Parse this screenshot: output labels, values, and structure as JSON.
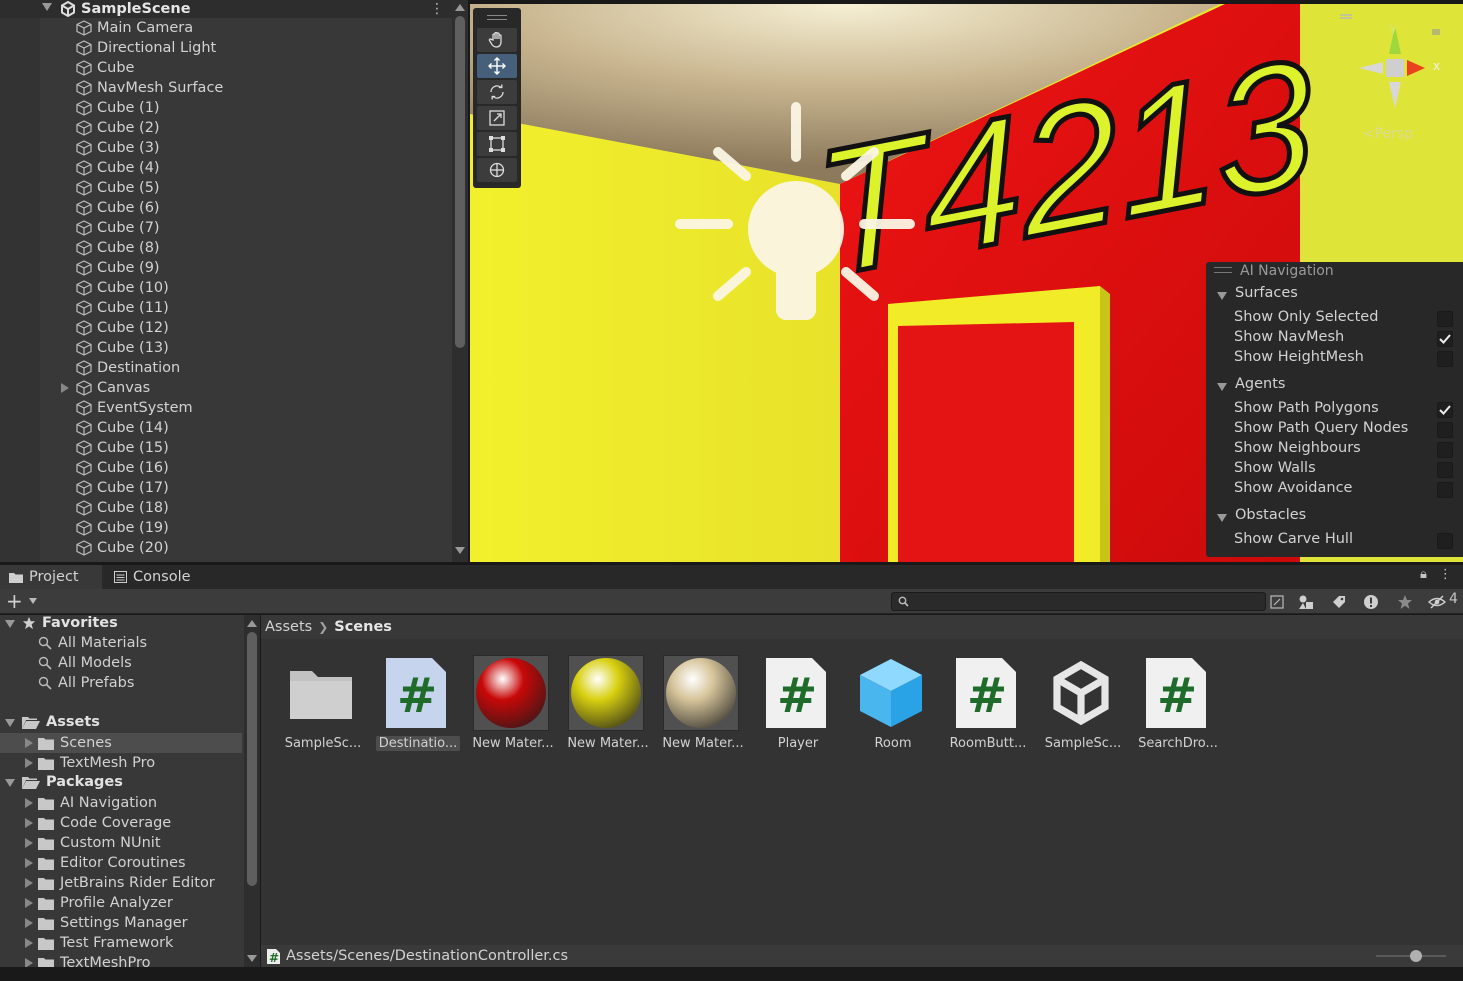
{
  "hierarchy": {
    "scene_name": "SampleScene",
    "items": [
      "Main Camera",
      "Directional Light",
      "Cube",
      "NavMesh Surface",
      "Cube (1)",
      "Cube (2)",
      "Cube (3)",
      "Cube (4)",
      "Cube (5)",
      "Cube (6)",
      "Cube (7)",
      "Cube (8)",
      "Cube (9)",
      "Cube (10)",
      "Cube (11)",
      "Cube (12)",
      "Cube (13)",
      "Destination",
      "Canvas",
      "EventSystem",
      "Cube (14)",
      "Cube (15)",
      "Cube (16)",
      "Cube (17)",
      "Cube (18)",
      "Cube (19)",
      "Cube (20)"
    ]
  },
  "scene_view": {
    "wall_sign": "T4213",
    "persp_label": "Persp",
    "gizmo_axes": {
      "y": "y",
      "x": "x"
    },
    "tools": [
      "hand-tool",
      "move-tool",
      "rotate-tool",
      "scale-tool",
      "rect-tool",
      "transform-tool"
    ],
    "active_tool": "move-tool"
  },
  "ai_navigation": {
    "title": "AI Navigation",
    "sections": [
      {
        "name": "Surfaces",
        "options": [
          {
            "label": "Show Only Selected",
            "checked": false
          },
          {
            "label": "Show NavMesh",
            "checked": true
          },
          {
            "label": "Show HeightMesh",
            "checked": false
          }
        ]
      },
      {
        "name": "Agents",
        "options": [
          {
            "label": "Show Path Polygons",
            "checked": true
          },
          {
            "label": "Show Path Query Nodes",
            "checked": false
          },
          {
            "label": "Show Neighbours",
            "checked": false
          },
          {
            "label": "Show Walls",
            "checked": false
          },
          {
            "label": "Show Avoidance",
            "checked": false
          }
        ]
      },
      {
        "name": "Obstacles",
        "options": [
          {
            "label": "Show Carve Hull",
            "checked": false
          }
        ]
      }
    ]
  },
  "tabs": {
    "project": "Project",
    "console": "Console"
  },
  "toolbar": {
    "add_label": "+",
    "hidden_count": "4",
    "search_placeholder": ""
  },
  "project_tree": {
    "favorites": {
      "label": "Favorites",
      "items": [
        "All Materials",
        "All Models",
        "All Prefabs"
      ]
    },
    "assets": {
      "label": "Assets",
      "items": [
        "Scenes",
        "TextMesh Pro"
      ]
    },
    "packages": {
      "label": "Packages",
      "items": [
        "AI Navigation",
        "Code Coverage",
        "Custom NUnit",
        "Editor Coroutines",
        "JetBrains Rider Editor",
        "Profile Analyzer",
        "Settings Manager",
        "Test Framework",
        "TextMeshPro"
      ]
    }
  },
  "breadcrumb": [
    "Assets",
    "Scenes"
  ],
  "assets": [
    {
      "name": "SampleSc...",
      "kind": "folder"
    },
    {
      "name": "Destinatio...",
      "kind": "script",
      "selected": true
    },
    {
      "name": "New Mater...",
      "kind": "material",
      "color": "#c80808"
    },
    {
      "name": "New Mater...",
      "kind": "material",
      "color": "#d8d010"
    },
    {
      "name": "New Mater...",
      "kind": "material",
      "color": "#d6c49a"
    },
    {
      "name": "Player",
      "kind": "script"
    },
    {
      "name": "Room",
      "kind": "prefab"
    },
    {
      "name": "RoomButt...",
      "kind": "script"
    },
    {
      "name": "SampleSc...",
      "kind": "scene"
    },
    {
      "name": "SearchDro...",
      "kind": "script"
    }
  ],
  "status": {
    "path": "Assets/Scenes/DestinationController.cs"
  },
  "colors": {
    "wall_yellow": "#ece82c",
    "wall_red": "#e01010",
    "selection": "#46607c"
  }
}
